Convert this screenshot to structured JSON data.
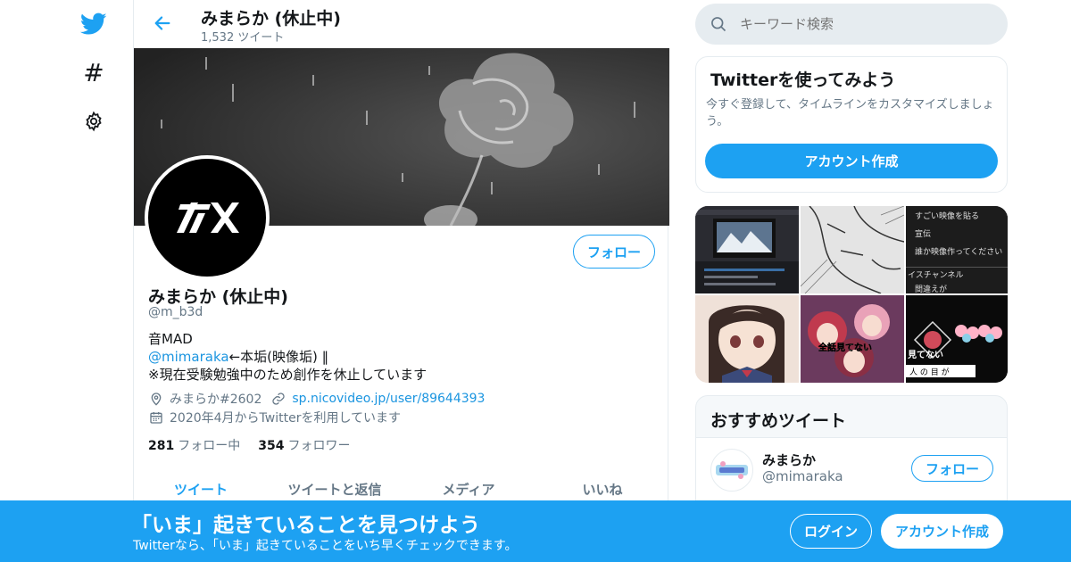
{
  "nav": {
    "icons": [
      "twitter-bird-icon",
      "hashtag-icon",
      "settings-gear-icon"
    ],
    "hashtag_glyph": "#"
  },
  "header": {
    "title": "みまらか (休止中)",
    "tweet_count": "1,532 ツイート"
  },
  "profile": {
    "name": "みまらか (休止中)",
    "handle": "@m_b3d",
    "follow_label": "フォロー",
    "bio_line1": "音MAD",
    "bio_link": "@mimaraka",
    "bio_line2_rest": "←本垢(映像垢) ‖",
    "bio_line3": "※現在受験勉強中のため創作を休止しています",
    "location": "みまらか#2602",
    "website": "sp.nicovideo.jp/user/89644393",
    "joined": "2020年4月からTwitterを利用しています",
    "following_count": "281",
    "following_label": "フォロー中",
    "followers_count": "354",
    "followers_label": "フォロワー"
  },
  "tabs": [
    {
      "label": "ツイート",
      "active": true
    },
    {
      "label": "ツイートと返信",
      "active": false
    },
    {
      "label": "メディア",
      "active": false
    },
    {
      "label": "いいね",
      "active": false
    }
  ],
  "search": {
    "placeholder": "キーワード検索"
  },
  "try_card": {
    "title": "Twitterを使ってみよう",
    "description": "今すぐ登録して、タイムラインをカスタマイズしましょう。",
    "button": "アカウント作成"
  },
  "media_thumbs": {
    "t3_lines": [
      "すごい映像を貼る",
      "宣伝",
      "誰か映像作ってください",
      "イスチャンネル",
      "間違えが"
    ],
    "t5_caption": "全話見てない",
    "t6_caption1": "見てない",
    "t6_caption2": "人 の 目 が"
  },
  "recommended": {
    "title": "おすすめツイート",
    "name": "みまらか",
    "handle": "@mimaraka",
    "follow_label": "フォロー"
  },
  "bottom_banner": {
    "title": "「いま」起きていることを見つけよう",
    "subtitle": "Twitterなら、「いま」起きていることをいち早くチェックできます。",
    "login": "ログイン",
    "signup": "アカウント作成"
  },
  "colors": {
    "accent": "#1da1f2",
    "link": "#1b95e0",
    "muted": "#657786"
  }
}
